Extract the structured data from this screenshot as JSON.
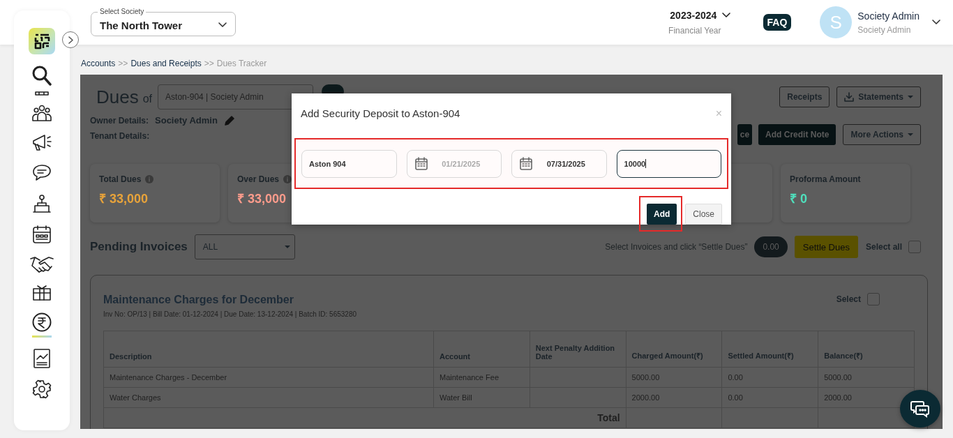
{
  "header": {
    "society_label": "Select Society",
    "society": "The North Tower",
    "year": "2023-2024",
    "year_label": "Financial Year",
    "faq": "FAQ",
    "avatar_letter": "S",
    "user_name": "Society Admin",
    "user_role": "Society Admin"
  },
  "sidebar": {
    "items": [
      {
        "selected": false
      },
      {
        "selected": false
      },
      {
        "selected": false
      },
      {
        "selected": false
      },
      {
        "selected": false
      },
      {
        "selected": false
      },
      {
        "selected": false
      },
      {
        "selected": false
      },
      {
        "selected": false
      },
      {
        "selected": true
      },
      {
        "selected": false
      },
      {
        "selected": false
      }
    ]
  },
  "breadcrumb": [
    {
      "label": "Accounts",
      "current": false,
      "separator": ">>"
    },
    {
      "label": "Dues and Receipts",
      "current": false,
      "separator": ">>"
    },
    {
      "label": "Dues Tracker",
      "current": true
    }
  ],
  "dues": {
    "title": "Dues",
    "of": "of",
    "member": "Aston-904 | Society Admin",
    "owner_label": "Owner Details:",
    "owner": "Society Admin",
    "tenant_label": "Tenant Details:"
  },
  "actions_top": [
    {
      "label": "Receipts",
      "kind": "outline",
      "caret": false
    },
    {
      "label": "Statements",
      "kind": "download",
      "caret": true
    }
  ],
  "actions_second": [
    {
      "label": "ce",
      "kind": "dark",
      "caret": false
    },
    {
      "label": "Add Credit Note",
      "kind": "dark",
      "caret": false
    },
    {
      "label": "More Actions",
      "kind": "outline",
      "caret": true
    }
  ],
  "summary_cards": [
    {
      "kind": "amount",
      "title": "Total Dues",
      "amount": "₹ 33,000",
      "color": "#e8a33a",
      "info": true
    },
    {
      "kind": "amount",
      "title": "Over Dues",
      "amount": "₹ 33,000",
      "color": "#ff9c8c",
      "info": true
    },
    {
      "kind": "covered"
    },
    {
      "kind": "amount",
      "title": "Proforma Amount",
      "amount": "₹ 0",
      "color": "#4fe0bd",
      "info": false
    }
  ],
  "pending": {
    "title": "Pending Invoices",
    "filter": "ALL",
    "hint": "Select Invoices and click “Settle Dues”",
    "total": "0.00",
    "settle": "Settle Dues",
    "select_all": "Select all",
    "select_all_checked": false
  },
  "invoice": {
    "title": "Maintenance Charges for December",
    "meta": "Inv No: OP/13 | Bill Date: 01-12-2024 | Due Date: 13-12-2024 | Batch ID: 5653280",
    "select": "Select",
    "checked": false,
    "columns": [
      "Description",
      "Account",
      "Next Penalty Addition Date",
      "Charged Amount(₹)",
      "Settled Amount(₹)",
      "Balance(₹)"
    ],
    "rows": [
      [
        "Maintenance Charges - December",
        "Maintenance Fee",
        "",
        "5000.00",
        "0.00",
        "5000.00"
      ],
      [
        "Water Charges",
        "Water Bill",
        "",
        "2000.00",
        "0.00",
        "2000.00"
      ]
    ],
    "total_label": "Total"
  },
  "modal": {
    "title": "Add Security Deposit to Aston-904",
    "close": "×",
    "highlighted": true,
    "fields": [
      {
        "kind": "text",
        "value": "Aston 904",
        "disabled": false,
        "focused": false
      },
      {
        "kind": "date",
        "value": "01/21/2025",
        "disabled": true,
        "focused": false
      },
      {
        "kind": "date",
        "value": "07/31/2025",
        "disabled": false,
        "focused": false
      },
      {
        "kind": "amount",
        "value": "10000",
        "disabled": false,
        "focused": true
      }
    ],
    "buttons": [
      {
        "label": "Add",
        "kind": "primary",
        "highlighted": true
      },
      {
        "label": "Close",
        "kind": "secondary",
        "highlighted": false
      }
    ]
  }
}
